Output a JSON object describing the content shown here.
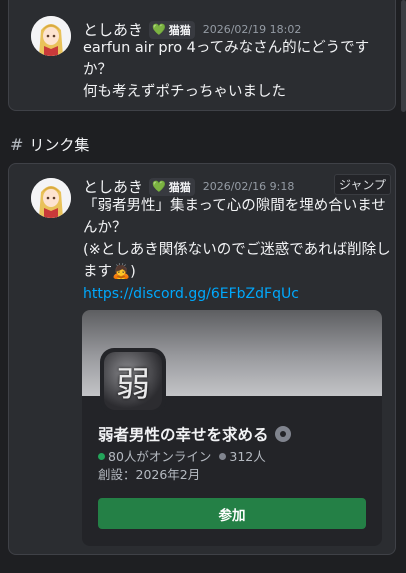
{
  "message1": {
    "author": "としあき",
    "tag": "猫猫",
    "timestamp": "2026/02/19 18:02",
    "text": "earfun air pro 4ってみなさん的にどうですか？\n何も考えずポチっちゃいました"
  },
  "section": {
    "title": "リンク集"
  },
  "message2": {
    "author": "としあき",
    "tag": "猫猫",
    "timestamp": "2026/02/16 9:18",
    "jump_label": "ジャンプ",
    "text_line1": "「弱者男性」集まって心の隙間を埋め合いませんか？",
    "text_line2": "(※としあき関係ないのでご迷惑であれば削除します",
    "text_line2_end": ")",
    "emoji": "🙇",
    "link": "https://discord.gg/6EFbZdFqUc"
  },
  "invite": {
    "icon_char": "弱",
    "guild_name": "弱者男性の幸せを求める",
    "online": "80人がオンライン",
    "members": "312人",
    "created": "創設：2026年2月",
    "join_label": "参加",
    "colors": {
      "online": "#23a55a",
      "members": "#80848e",
      "join": "#248046",
      "link": "#00a8fc"
    }
  }
}
